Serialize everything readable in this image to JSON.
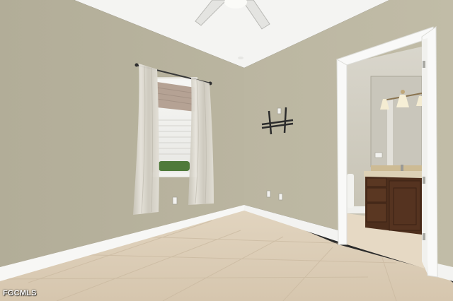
{
  "photo": {
    "watermark": "FGCMLS"
  },
  "colors": {
    "wall_left": "#b5b09b",
    "wall_back": "#bdb8a3",
    "ceiling": "#f4f4f2",
    "floor_tile": "#dccdb7",
    "baseboard": "#f7f7f5",
    "door_trim": "#f9f9f8",
    "vanity_wood": "#4d2e1c",
    "counter": "#d8cbb0"
  }
}
